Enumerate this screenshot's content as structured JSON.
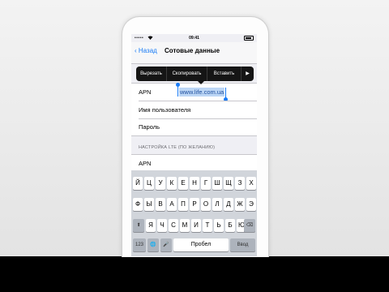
{
  "status_bar": {
    "carrier": "•••••",
    "wifi_icon": "wifi-icon",
    "time": "09:41",
    "battery_icon": "battery-icon"
  },
  "navbar": {
    "back_label": "Назад",
    "title": "Сотовые данные"
  },
  "edit_menu": {
    "cut": "Вырезать",
    "copy": "Скопировать",
    "paste": "Вставить",
    "more": "▶"
  },
  "cellular_fields": {
    "apn_label": "APN",
    "apn_value": "www.life.com.ua",
    "username_placeholder": "Имя пользователя",
    "password_placeholder": "Пароль"
  },
  "lte_section": {
    "header": "НАСТРОЙКА LTE (ПО ЖЕЛАНИЮ)",
    "apn_label": "APN"
  },
  "keyboard": {
    "row1": [
      "Й",
      "Ц",
      "У",
      "К",
      "Е",
      "Н",
      "Г",
      "Ш",
      "Щ",
      "З",
      "Х"
    ],
    "row2": [
      "Ф",
      "Ы",
      "В",
      "А",
      "П",
      "Р",
      "О",
      "Л",
      "Д",
      "Ж",
      "Э"
    ],
    "row3": [
      "Я",
      "Ч",
      "С",
      "М",
      "И",
      "Т",
      "Ь",
      "Б",
      "Ю"
    ],
    "shift": "⬆",
    "backspace": "⌫",
    "numbers": "123",
    "globe": "🌐",
    "mic": "🎤",
    "space": "Пробел",
    "return": "Ввод"
  }
}
